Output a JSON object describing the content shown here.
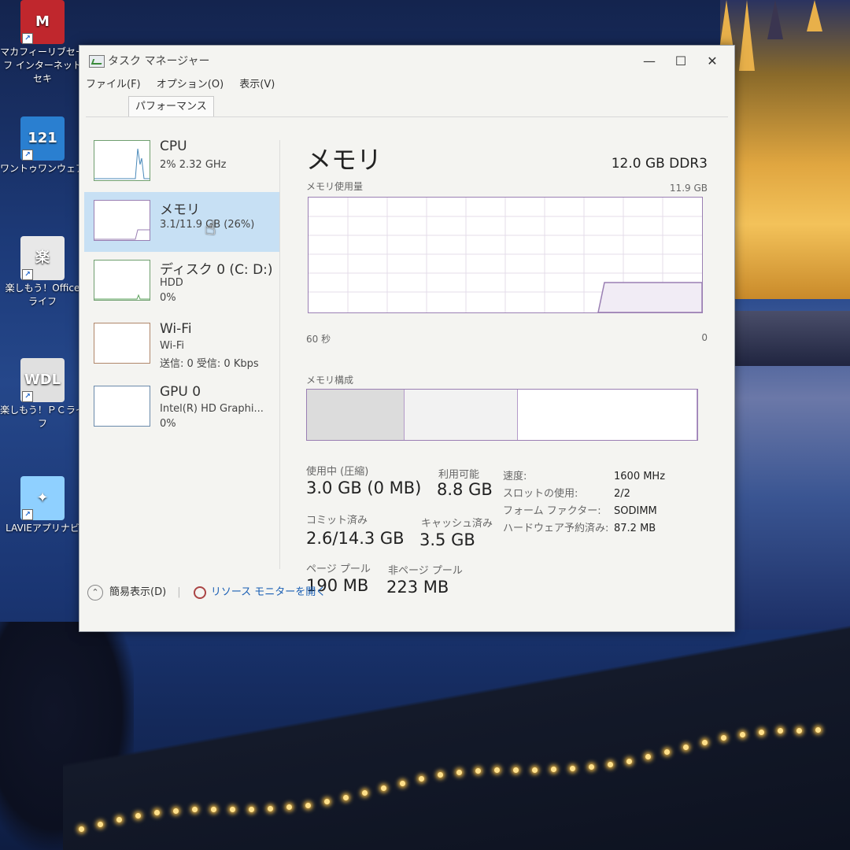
{
  "desktop": {
    "icons": [
      {
        "label": "マカフィーリブセーフ インターネットセキ",
        "color": "#c0272d",
        "glyph": "M"
      },
      {
        "label": "ワントゥワンウェア",
        "color": "#2a7fd0",
        "glyph": "121"
      },
      {
        "label": "楽しもう！Office ライフ",
        "color": "#e8e8e8",
        "glyph": "楽"
      },
      {
        "label": "楽しもう！ＰＣライフ",
        "color": "#e0e0e0",
        "glyph": "WDL"
      },
      {
        "label": "LAVIEアプリナビ",
        "color": "#8fd0ff",
        "glyph": "✦"
      }
    ]
  },
  "window": {
    "title": "タスク マネージャー",
    "controls": {
      "minimize": "—",
      "maximize": "☐",
      "close": "✕"
    },
    "menu": [
      "ファイル(F)",
      "オプション(O)",
      "表示(V)"
    ],
    "tab": "パフォーマンス",
    "sidebar": [
      {
        "name": "CPU",
        "line1": "2% 2.32 GHz",
        "line2": ""
      },
      {
        "name": "メモリ",
        "line1": "3.1/11.9 GB (26%)",
        "line2": ""
      },
      {
        "name": "ディスク 0 (C: D:)",
        "line1": "HDD",
        "line2": "0%"
      },
      {
        "name": "Wi-Fi",
        "line1": "Wi-Fi",
        "line2": "送信: 0 受信: 0 Kbps"
      },
      {
        "name": "GPU 0",
        "line1": "Intel(R) HD Graphi...",
        "line2": "0%"
      }
    ],
    "main": {
      "title": "メモリ",
      "type": "12.0 GB DDR3",
      "usage_label": "メモリ使用量",
      "usage_max": "11.9 GB",
      "time_left": "60 秒",
      "time_right": "0",
      "composition_label": "メモリ構成",
      "composition_fractions": [
        0.25,
        0.29,
        0.46
      ],
      "stats": [
        {
          "label": "使用中 (圧縮)",
          "value": "3.0 GB (0 MB)"
        },
        {
          "label": "利用可能",
          "value": "8.8 GB"
        },
        {
          "label": "コミット済み",
          "value": "2.6/14.3 GB"
        },
        {
          "label": "キャッシュ済み",
          "value": "3.5 GB"
        },
        {
          "label": "ページ プール",
          "value": "190 MB"
        },
        {
          "label": "非ページ プール",
          "value": "223 MB"
        }
      ],
      "props": [
        {
          "label": "速度:",
          "value": "1600 MHz"
        },
        {
          "label": "スロットの使用:",
          "value": "2/2"
        },
        {
          "label": "フォーム ファクター:",
          "value": "SODIMM"
        },
        {
          "label": "ハードウェア予約済み:",
          "value": "87.2 MB"
        }
      ]
    },
    "footer": {
      "fewer_details": "簡易表示(D)",
      "resource_monitor": "リソース モニターを開く"
    }
  },
  "colors": {
    "accent_selected": "#c7e0f4",
    "memory_border": "#9a7fb3",
    "link": "#1a5fb4"
  }
}
